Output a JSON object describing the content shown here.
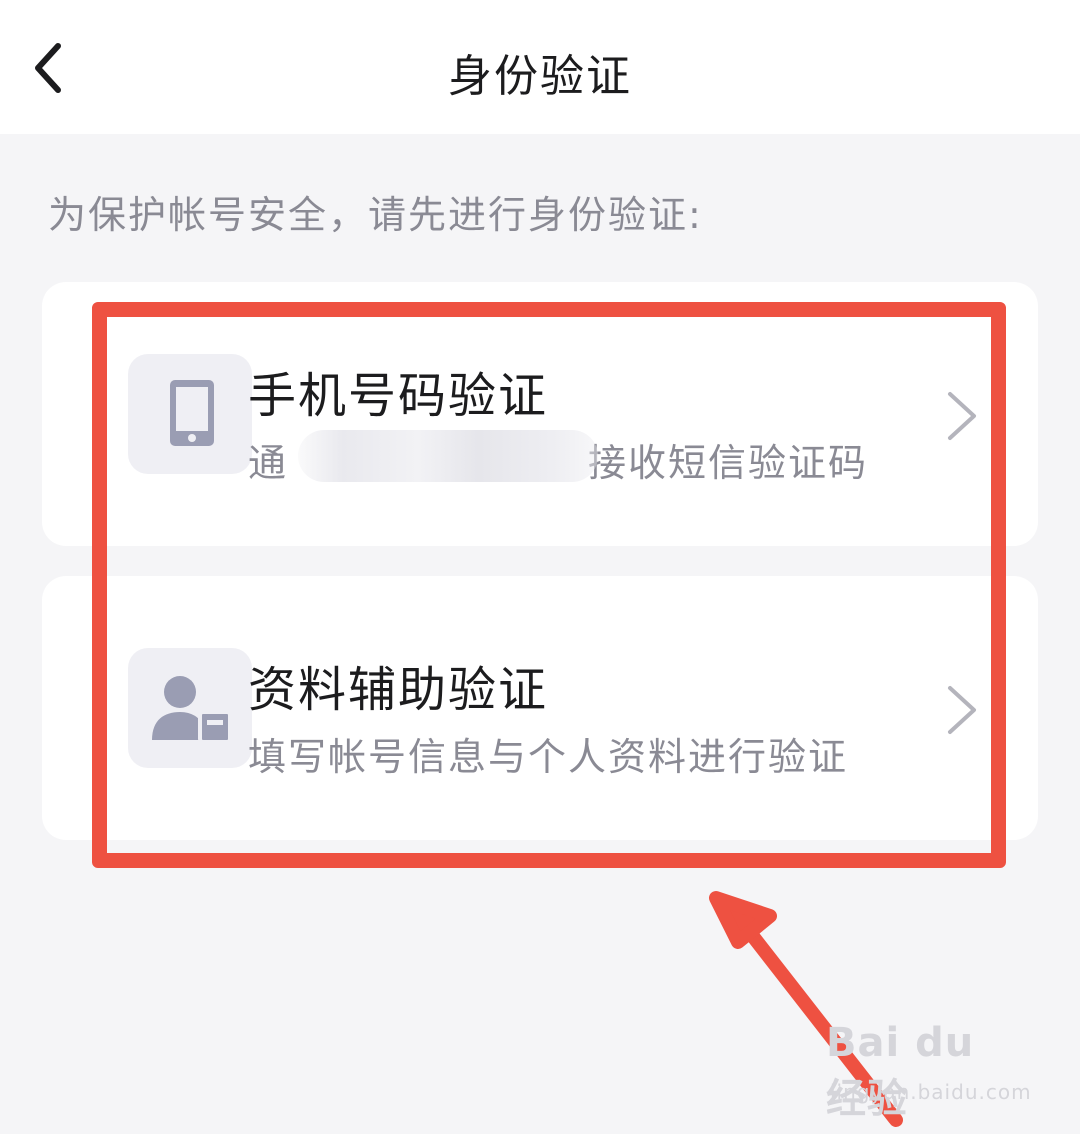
{
  "header": {
    "title": "身份验证",
    "back_icon": "chevron-left-icon"
  },
  "hint": "为保护帐号安全，请先进行身份验证:",
  "options": [
    {
      "title": "手机号码验证",
      "subtitle_start": "通",
      "subtitle_end": "接收短信验证码",
      "icon": "phone-icon"
    },
    {
      "title": "资料辅助验证",
      "subtitle": "填写帐号信息与个人资料进行验证",
      "icon": "user-card-icon"
    }
  ],
  "colors": {
    "highlight": "#ee5141",
    "background": "#f5f5f7",
    "icon": "#9a9db3"
  },
  "watermark": {
    "main": "Bai du 经验",
    "sub": "jingyan.baidu.com"
  }
}
